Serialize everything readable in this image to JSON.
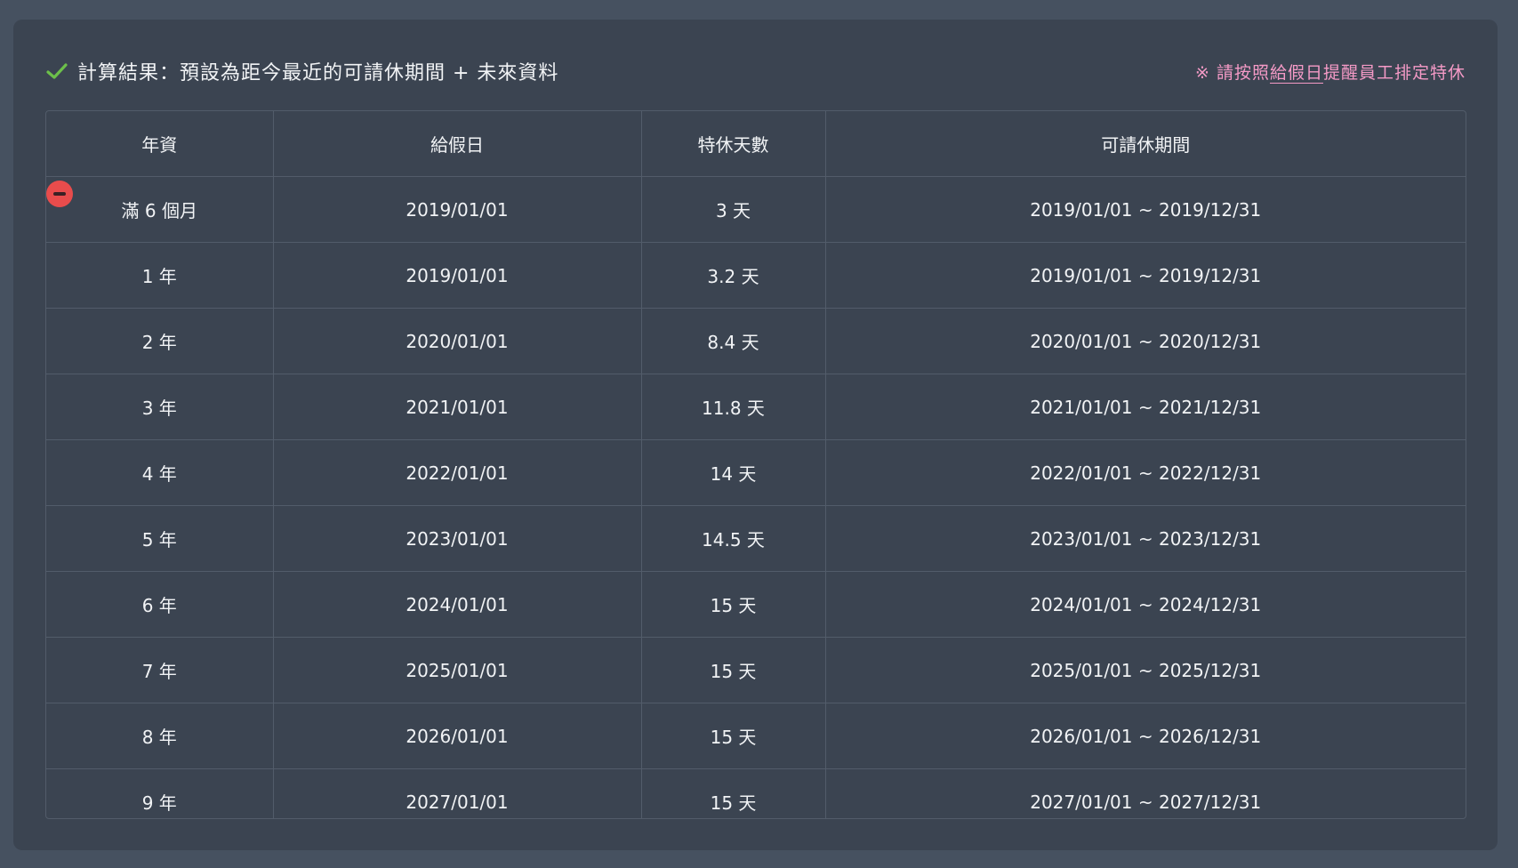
{
  "header": {
    "title": "計算結果：預設為距今最近的可請休期間 + 未來資料",
    "note_prefix": "※ 請按照",
    "note_highlight": "給假日",
    "note_suffix": "提醒員工排定特休",
    "check_icon": "check-icon",
    "accent_green": "#6cc04a",
    "note_color": "#f49ac6"
  },
  "table": {
    "columns": [
      "年資",
      "給假日",
      "特休天數",
      "可請休期間"
    ],
    "rows": [
      {
        "seniority": "滿 6 個月",
        "grant_date": "2019/01/01",
        "days": "3 天",
        "period": "2019/01/01 ~ 2019/12/31"
      },
      {
        "seniority": "1 年",
        "grant_date": "2019/01/01",
        "days": "3.2 天",
        "period": "2019/01/01 ~ 2019/12/31"
      },
      {
        "seniority": "2 年",
        "grant_date": "2020/01/01",
        "days": "8.4 天",
        "period": "2020/01/01 ~ 2020/12/31"
      },
      {
        "seniority": "3 年",
        "grant_date": "2021/01/01",
        "days": "11.8 天",
        "period": "2021/01/01 ~ 2021/12/31"
      },
      {
        "seniority": "4 年",
        "grant_date": "2022/01/01",
        "days": "14 天",
        "period": "2022/01/01 ~ 2022/12/31"
      },
      {
        "seniority": "5 年",
        "grant_date": "2023/01/01",
        "days": "14.5 天",
        "period": "2023/01/01 ~ 2023/12/31"
      },
      {
        "seniority": "6 年",
        "grant_date": "2024/01/01",
        "days": "15 天",
        "period": "2024/01/01 ~ 2024/12/31"
      },
      {
        "seniority": "7 年",
        "grant_date": "2025/01/01",
        "days": "15 天",
        "period": "2025/01/01 ~ 2025/12/31"
      },
      {
        "seniority": "8 年",
        "grant_date": "2026/01/01",
        "days": "15 天",
        "period": "2026/01/01 ~ 2026/12/31"
      },
      {
        "seniority": "9 年",
        "grant_date": "2027/01/01",
        "days": "15 天",
        "period": "2027/01/01 ~ 2027/12/31"
      }
    ]
  },
  "remove_button": {
    "icon": "minus-circle-icon",
    "color": "#e84c4c"
  }
}
